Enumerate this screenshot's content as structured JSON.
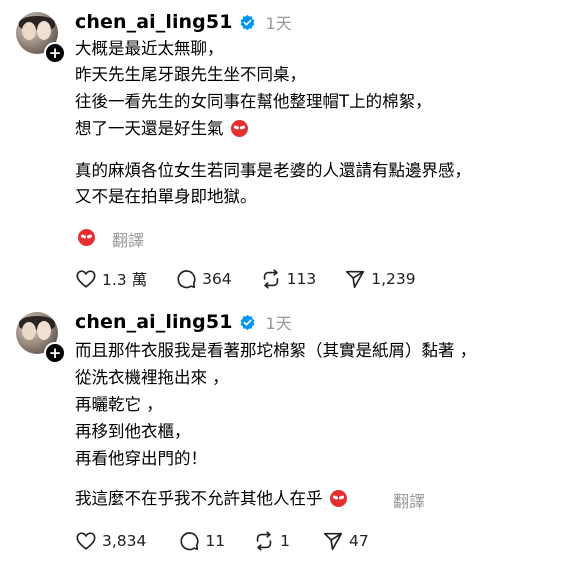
{
  "posts": [
    {
      "username": "chen_ai_ling51",
      "time": "1天",
      "lines": [
        "大概是最近太無聊，",
        "昨天先生尾牙跟先生坐不同桌，",
        "往後一看先生的女同事在幫他整理帽T上的棉絮，",
        "想了一天還是好生氣",
        "真的麻煩各位女生若同事是老婆的人還請有點邊界感，",
        "又不是在拍單身即地獄。"
      ],
      "translate_label": "翻譯",
      "likes": "1.3 萬",
      "comments": "364",
      "reposts": "113",
      "shares": "1,239"
    },
    {
      "username": "chen_ai_ling51",
      "time": "1天",
      "lines": [
        "而且那件衣服我是看著那坨棉絮（其實是紙屑）黏著 ，",
        "從洗衣機裡拖出來 ，",
        "再曬乾它 ，",
        "再移到他衣櫃，",
        "再看他穿出門的！",
        "我這麼不在乎我不允許其他人在乎"
      ],
      "translate_label": "翻譯",
      "likes": "3,834",
      "comments": "11",
      "reposts": "1",
      "shares": "47"
    }
  ],
  "icons": {
    "verified": "verified-badge-icon",
    "follow": "plus-icon",
    "angry_emoji": "angry-face-icon",
    "like": "heart-icon",
    "comment": "speech-bubble-icon",
    "repost": "repost-icon",
    "share": "send-icon"
  },
  "colors": {
    "verified": "#0095f6",
    "emoji": "#e53030",
    "muted": "#999999"
  }
}
